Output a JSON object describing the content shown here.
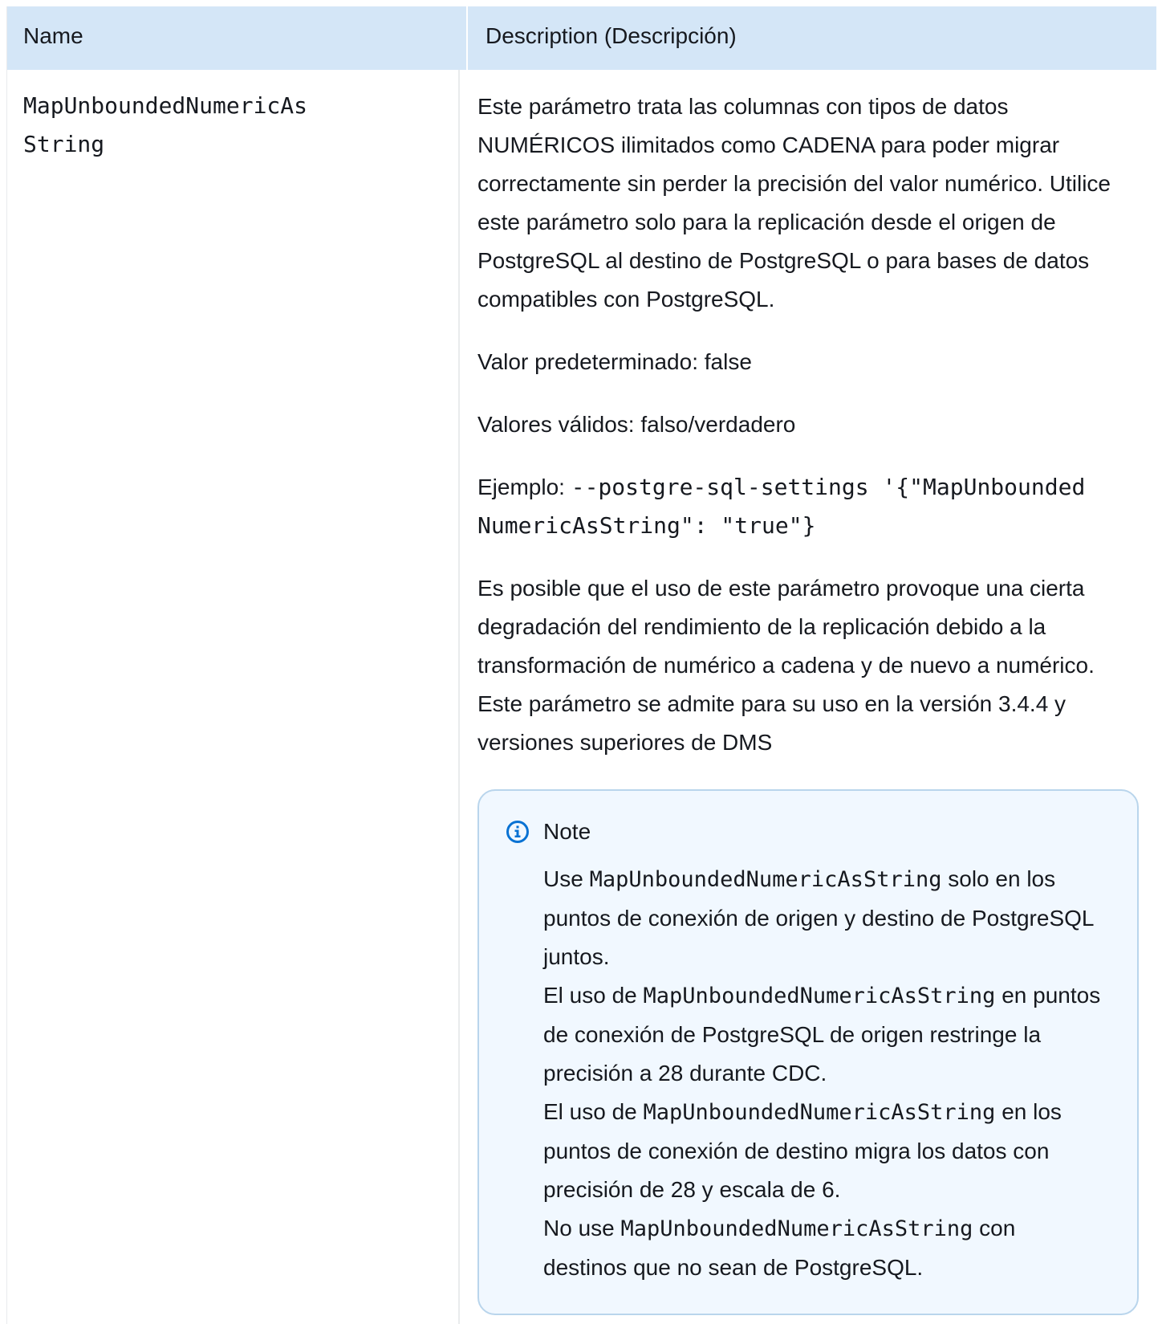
{
  "table": {
    "headers": {
      "name": "Name",
      "description": "Description (Descripción)"
    },
    "row": {
      "param_name": "MapUnboundedNumericAsString",
      "description": "Este parámetro trata las columnas con tipos de datos NUMÉRICOS ilimitados como CADENA para poder migrar correctamente sin perder la precisión del valor numérico. Utilice este parámetro solo para la replicación desde el origen de PostgreSQL al destino de PostgreSQL o para bases de datos compatibles con PostgreSQL.",
      "default_value": "Valor predeterminado: false",
      "valid_values": "Valores válidos: falso/verdadero",
      "example_label": "Ejemplo: ",
      "example_code": "--postgre-sql-settings '{\"MapUnboundedNumericAsString\": \"true\"}",
      "performance_note": "Es posible que el uso de este parámetro provoque una cierta degradación del rendimiento de la replicación debido a la transformación de numérico a cadena y de nuevo a numérico. Este parámetro se admite para su uso en la versión 3.4.4 y versiones superiores de DMS"
    }
  },
  "note": {
    "icon": "info-icon",
    "title": "Note",
    "items": [
      {
        "before": "Use ",
        "code": "MapUnboundedNumericAsString",
        "after": " solo en los puntos de conexión de origen y destino de PostgreSQL juntos."
      },
      {
        "before": "El uso de ",
        "code": "MapUnboundedNumericAsString",
        "after": " en puntos de conexión de PostgreSQL de origen restringe la precisión a 28 durante CDC."
      },
      {
        "before": "El uso de ",
        "code": "MapUnboundedNumericAsString",
        "after": " en los puntos de conexión de destino migra los datos con precisión de 28 y escala de 6."
      },
      {
        "before": "No use ",
        "code": "MapUnboundedNumericAsString",
        "after": " con destinos que no sean de PostgreSQL."
      }
    ]
  },
  "colors": {
    "header_bg": "#d4e6f7",
    "note_bg": "#f1f8ff",
    "note_border": "#b9d5ec",
    "icon": "#0972d3"
  }
}
